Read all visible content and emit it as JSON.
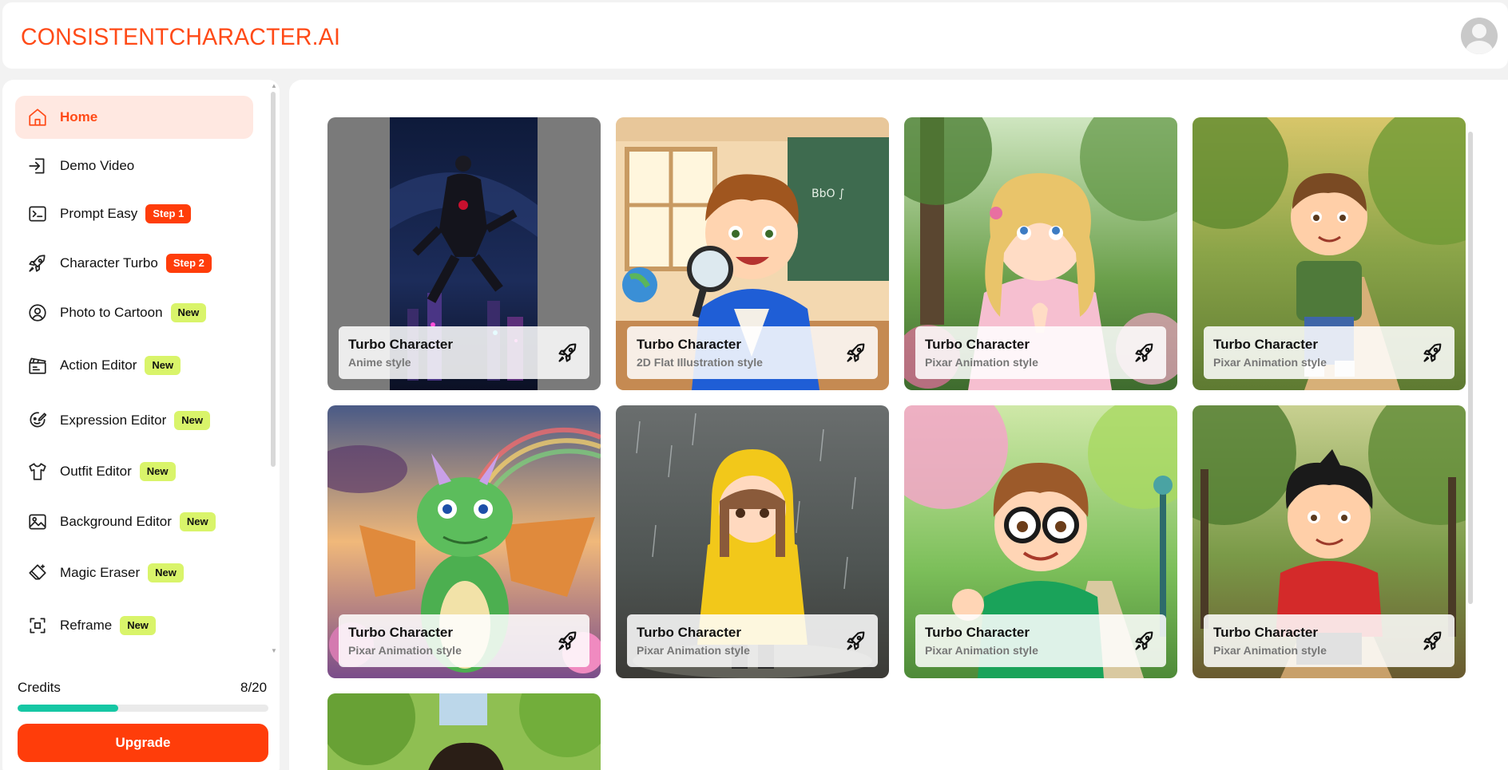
{
  "header": {
    "logo": "CONSISTENTCHARACTER.AI"
  },
  "sidebar": {
    "items": [
      {
        "label": "Home",
        "icon": "home-icon",
        "active": true
      },
      {
        "label": "Demo Video",
        "icon": "login-arrow-icon"
      },
      {
        "label": "Prompt Easy",
        "icon": "terminal-icon",
        "badge": "Step 1"
      },
      {
        "label": "Character Turbo",
        "icon": "rocket-icon",
        "badge": "Step 2"
      },
      {
        "label": "Photo to Cartoon",
        "icon": "user-circle-icon",
        "badge": "New"
      },
      {
        "label": "Action Editor",
        "icon": "clapperboard-icon",
        "badge": "New"
      },
      {
        "label": "Expression Editor",
        "icon": "face-edit-icon",
        "badge": "New"
      },
      {
        "label": "Outfit Editor",
        "icon": "shirt-icon",
        "badge": "New"
      },
      {
        "label": "Background Editor",
        "icon": "image-icon",
        "badge": "New"
      },
      {
        "label": "Magic Eraser",
        "icon": "eraser-icon",
        "badge": "New"
      },
      {
        "label": "Reframe",
        "icon": "frame-icon",
        "badge": "New"
      }
    ],
    "credits": {
      "label": "Credits",
      "value": "8/20",
      "fraction": 0.4
    },
    "upgrade_label": "Upgrade"
  },
  "gallery": [
    {
      "title": "Turbo Character",
      "style": "Anime style",
      "scene": "ninja night city"
    },
    {
      "title": "Turbo Character",
      "style": "2D Flat Illustration style",
      "scene": "boy with magnifier in classroom"
    },
    {
      "title": "Turbo Character",
      "style": "Pixar Animation style",
      "scene": "girl in garden"
    },
    {
      "title": "Turbo Character",
      "style": "Pixar Animation style",
      "scene": "boy in park"
    },
    {
      "title": "Turbo Character",
      "style": "Pixar Animation style",
      "scene": "green dragon"
    },
    {
      "title": "Turbo Character",
      "style": "Pixar Animation style",
      "scene": "girl in yellow raincoat"
    },
    {
      "title": "Turbo Character",
      "style": "Pixar Animation style",
      "scene": "boy with glasses waving"
    },
    {
      "title": "Turbo Character",
      "style": "Pixar Animation style",
      "scene": "boy in red hoodie"
    },
    {
      "title": "",
      "style": "",
      "scene": "boy in trees (partial)"
    }
  ],
  "colors": {
    "accent": "#ff4a17",
    "new_badge": "#d9f46a",
    "progress": "#16c7a4"
  }
}
